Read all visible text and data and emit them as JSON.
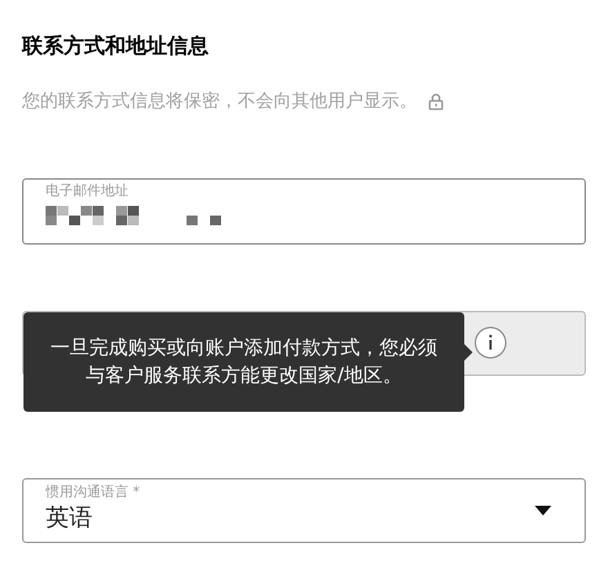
{
  "title": "联系方式和地址信息",
  "privacy_note": "您的联系方式信息将保密，不会向其他用户显示。",
  "email_field": {
    "label": "电子邮件地址",
    "redacted": true
  },
  "country_field": {
    "disabled": true
  },
  "tooltip": {
    "text": "一旦完成购买或向账户添加付款方式，您必须与客户服务联系方能更改国家/地区。"
  },
  "language_field": {
    "label": "惯用沟通语言 *",
    "value": "英语"
  }
}
